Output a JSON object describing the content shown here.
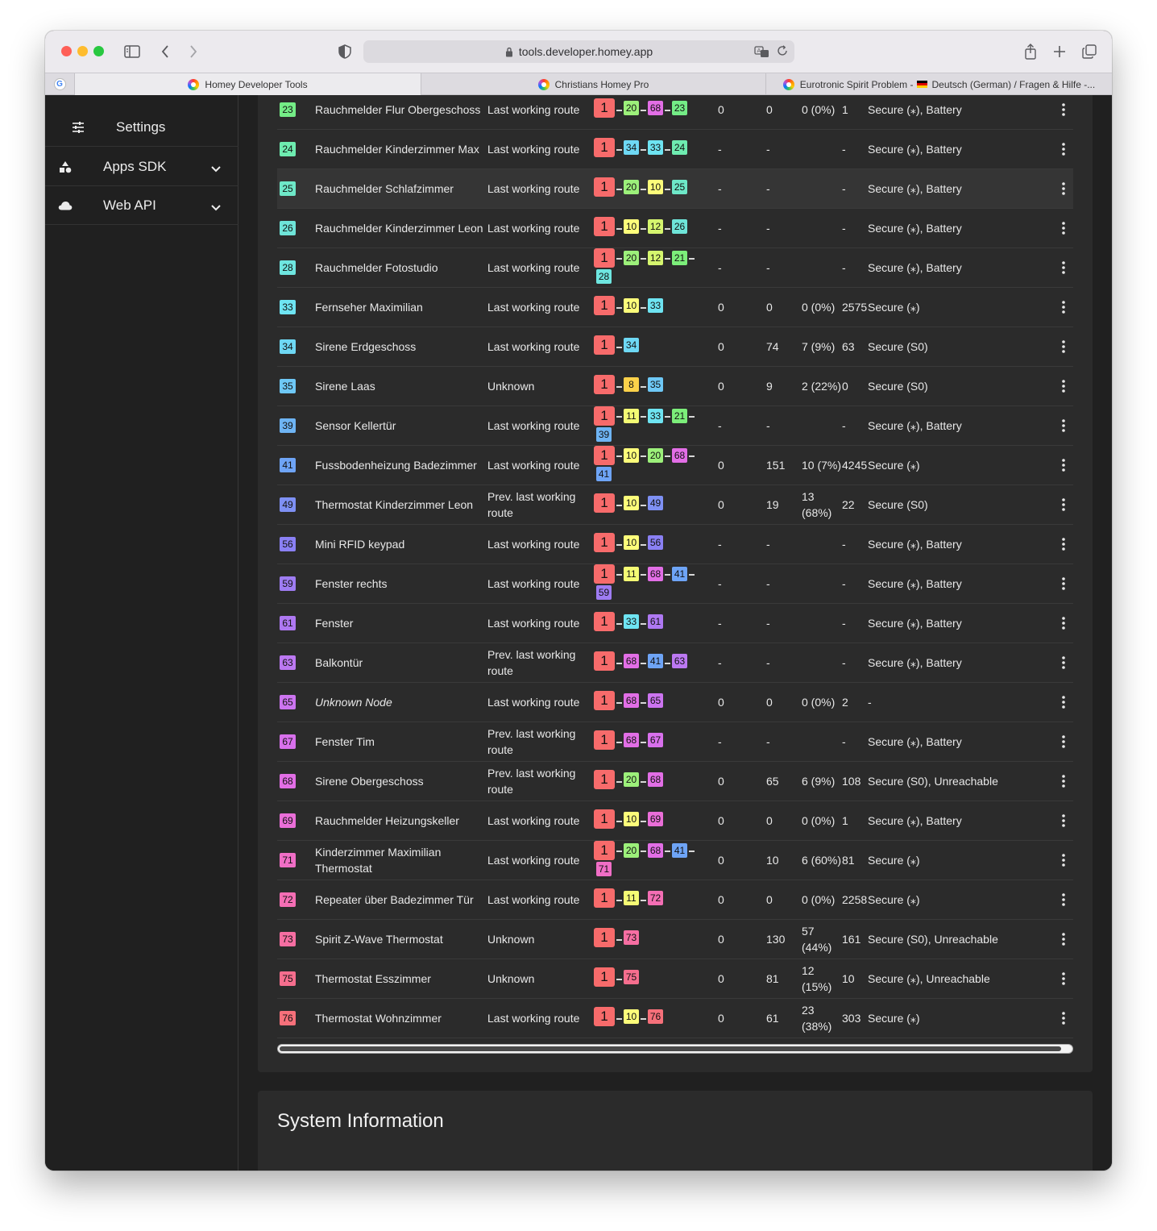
{
  "browser": {
    "url": "tools.developer.homey.app",
    "tabs": [
      {
        "label": "Homey Developer Tools",
        "active": true
      },
      {
        "label": "Christians Homey Pro",
        "active": false
      },
      {
        "label_before_flag": "Eurotronic Spirit Problem -",
        "label_after_flag": "Deutsch (German) / Fragen & Hilfe -...",
        "active": false
      }
    ]
  },
  "sidebar": {
    "items": [
      {
        "label": "Settings",
        "icon": "sliders-icon"
      },
      {
        "label": "Apps SDK",
        "icon": "shapes-icon"
      },
      {
        "label": "Web API",
        "icon": "cloud-icon"
      }
    ]
  },
  "colors": {
    "n10": "#fdfd7a",
    "n11": "#f4fb74",
    "n12": "#d5f56e",
    "n8": "#fbd14a",
    "n20": "#9cf07a",
    "n21": "#7cee7a",
    "n23": "#74ec86",
    "n24": "#6eecb0",
    "n25": "#6ee8c8",
    "n26": "#6ee4d8",
    "n28": "#6ee6e0",
    "n33": "#6ee4f2",
    "n34": "#6ed8f4",
    "n35": "#6ec8f6",
    "n39": "#6eb4f4",
    "n41": "#6ea4f6",
    "n49": "#7e90f4",
    "n56": "#8a80f4",
    "n59": "#9e7cf2",
    "n61": "#ae78f2",
    "n63": "#bc78f2",
    "n65": "#cc74f0",
    "n67": "#d870ec",
    "n68": "#e26ee6",
    "n69": "#ea6ed8",
    "n71": "#f06ec6",
    "n72": "#f46eb4",
    "n73": "#f66ea2",
    "n75": "#f66e8e",
    "n76": "#f6707a",
    "n1": "#f76b6b"
  },
  "rows": [
    {
      "id": "23",
      "name": "Rauchmelder Flur Obergeschoss",
      "route_type": "Last working route",
      "route": [
        "1",
        "20",
        "68",
        "23"
      ],
      "v1": "0",
      "v2": "0",
      "v3": "0 (0%)",
      "v4": "1",
      "security": "Secure (⁎), Battery"
    },
    {
      "id": "24",
      "name": "Rauchmelder Kinderzimmer Max",
      "route_type": "Last working route",
      "route": [
        "1",
        "34",
        "33",
        "24"
      ],
      "v1": "-",
      "v2": "-",
      "v3": "",
      "v4": "-",
      "security": "Secure (⁎), Battery"
    },
    {
      "id": "25",
      "name": "Rauchmelder Schlafzimmer",
      "route_type": "Last working route",
      "route": [
        "1",
        "20",
        "10",
        "25"
      ],
      "v1": "-",
      "v2": "-",
      "v3": "",
      "v4": "-",
      "security": "Secure (⁎), Battery",
      "highlight": true
    },
    {
      "id": "26",
      "name": "Rauchmelder Kinderzimmer Leon",
      "route_type": "Last working route",
      "route": [
        "1",
        "10",
        "12",
        "26"
      ],
      "v1": "-",
      "v2": "-",
      "v3": "",
      "v4": "-",
      "security": "Secure (⁎), Battery"
    },
    {
      "id": "28",
      "name": "Rauchmelder Fotostudio",
      "route_type": "Last working route",
      "route": [
        "1",
        "20",
        "12",
        "21",
        "28"
      ],
      "v1": "-",
      "v2": "-",
      "v3": "",
      "v4": "-",
      "security": "Secure (⁎), Battery"
    },
    {
      "id": "33",
      "name": "Fernseher Maximilian",
      "route_type": "Last working route",
      "route": [
        "1",
        "10",
        "33"
      ],
      "v1": "0",
      "v2": "0",
      "v3": "0 (0%)",
      "v4": "2575",
      "security": "Secure (⁎)"
    },
    {
      "id": "34",
      "name": "Sirene Erdgeschoss",
      "route_type": "Last working route",
      "route": [
        "1",
        "34"
      ],
      "v1": "0",
      "v2": "74",
      "v3": "7 (9%)",
      "v4": "63",
      "security": "Secure (S0)"
    },
    {
      "id": "35",
      "name": "Sirene Laas",
      "route_type": "Unknown",
      "route": [
        "1",
        "8",
        "35"
      ],
      "v1": "0",
      "v2": "9",
      "v3": "2 (22%)",
      "v4": "0",
      "security": "Secure (S0)"
    },
    {
      "id": "39",
      "name": "Sensor Kellertür",
      "route_type": "Last working route",
      "route": [
        "1",
        "11",
        "33",
        "21",
        "39"
      ],
      "v1": "-",
      "v2": "-",
      "v3": "",
      "v4": "-",
      "security": "Secure (⁎), Battery"
    },
    {
      "id": "41",
      "name": "Fussbodenheizung Badezimmer",
      "route_type": "Last working route",
      "route": [
        "1",
        "10",
        "20",
        "68",
        "41"
      ],
      "v1": "0",
      "v2": "151",
      "v3": "10 (7%)",
      "v4": "4245",
      "security": "Secure (⁎)"
    },
    {
      "id": "49",
      "name": "Thermostat Kinderzimmer Leon",
      "route_type": "Prev. last working route",
      "route": [
        "1",
        "10",
        "49"
      ],
      "v1": "0",
      "v2": "19",
      "v3": "13 (68%)",
      "v4": "22",
      "security": "Secure (S0)"
    },
    {
      "id": "56",
      "name": "Mini RFID keypad",
      "route_type": "Last working route",
      "route": [
        "1",
        "10",
        "56"
      ],
      "v1": "-",
      "v2": "-",
      "v3": "",
      "v4": "-",
      "security": "Secure (⁎), Battery"
    },
    {
      "id": "59",
      "name": "Fenster rechts",
      "route_type": "Last working route",
      "route": [
        "1",
        "11",
        "68",
        "41",
        "59"
      ],
      "v1": "-",
      "v2": "-",
      "v3": "",
      "v4": "-",
      "security": "Secure (⁎), Battery"
    },
    {
      "id": "61",
      "name": "Fenster",
      "route_type": "Last working route",
      "route": [
        "1",
        "33",
        "61"
      ],
      "v1": "-",
      "v2": "-",
      "v3": "",
      "v4": "-",
      "security": "Secure (⁎), Battery"
    },
    {
      "id": "63",
      "name": "Balkontür",
      "route_type": "Prev. last working route",
      "route": [
        "1",
        "68",
        "41",
        "63"
      ],
      "v1": "-",
      "v2": "-",
      "v3": "",
      "v4": "-",
      "security": "Secure (⁎), Battery"
    },
    {
      "id": "65",
      "name": "Unknown Node",
      "italic": true,
      "route_type": "Last working route",
      "route": [
        "1",
        "68",
        "65"
      ],
      "v1": "0",
      "v2": "0",
      "v3": "0 (0%)",
      "v4": "2",
      "security": "-"
    },
    {
      "id": "67",
      "name": "Fenster Tim",
      "route_type": "Prev. last working route",
      "route": [
        "1",
        "68",
        "67"
      ],
      "v1": "-",
      "v2": "-",
      "v3": "",
      "v4": "-",
      "security": "Secure (⁎), Battery"
    },
    {
      "id": "68",
      "name": "Sirene Obergeschoss",
      "route_type": "Prev. last working route",
      "route": [
        "1",
        "20",
        "68"
      ],
      "v1": "0",
      "v2": "65",
      "v3": "6 (9%)",
      "v4": "108",
      "security": "Secure (S0), Unreachable"
    },
    {
      "id": "69",
      "name": "Rauchmelder Heizungskeller",
      "route_type": "Last working route",
      "route": [
        "1",
        "10",
        "69"
      ],
      "v1": "0",
      "v2": "0",
      "v3": "0 (0%)",
      "v4": "1",
      "security": "Secure (⁎), Battery"
    },
    {
      "id": "71",
      "name": "Kinderzimmer Maximilian Thermostat",
      "route_type": "Last working route",
      "route": [
        "1",
        "20",
        "68",
        "41",
        "71"
      ],
      "v1": "0",
      "v2": "10",
      "v3": "6 (60%)",
      "v4": "81",
      "security": "Secure (⁎)"
    },
    {
      "id": "72",
      "name": "Repeater über Badezimmer Tür",
      "route_type": "Last working route",
      "route": [
        "1",
        "11",
        "72"
      ],
      "v1": "0",
      "v2": "0",
      "v3": "0 (0%)",
      "v4": "2258",
      "security": "Secure (⁎)"
    },
    {
      "id": "73",
      "name": "Spirit Z-Wave Thermostat",
      "route_type": "Unknown",
      "route": [
        "1",
        "73"
      ],
      "v1": "0",
      "v2": "130",
      "v3": "57 (44%)",
      "v4": "161",
      "security": "Secure (S0), Unreachable"
    },
    {
      "id": "75",
      "name": "Thermostat Esszimmer",
      "route_type": "Unknown",
      "route": [
        "1",
        "75"
      ],
      "v1": "0",
      "v2": "81",
      "v3": "12 (15%)",
      "v4": "10",
      "security": "Secure (⁎), Unreachable"
    },
    {
      "id": "76",
      "name": "Thermostat Wohnzimmer",
      "route_type": "Last working route",
      "route": [
        "1",
        "10",
        "76"
      ],
      "v1": "0",
      "v2": "61",
      "v3": "23 (38%)",
      "v4": "303",
      "security": "Secure (⁎)"
    }
  ],
  "system_info": {
    "title": "System Information"
  }
}
